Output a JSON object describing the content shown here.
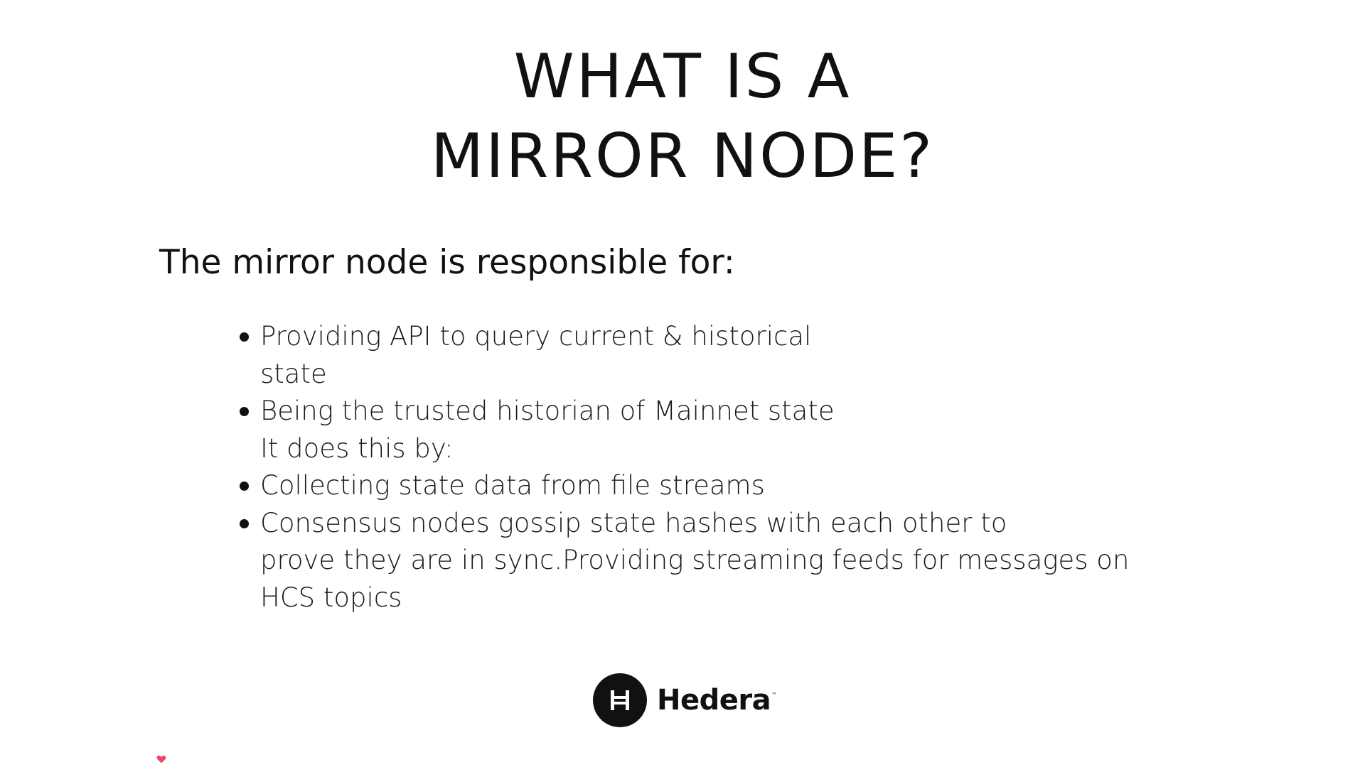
{
  "slide": {
    "title_line1": "WHAT IS A",
    "title_line2": "MIRROR NODE?",
    "subtitle": "The mirror node is responsible for:",
    "bullets": [
      {
        "lines": [
          "Providing API to query current & historical",
          "state"
        ],
        "bullet": true
      },
      {
        "lines": [
          "Being the trusted historian of Mainnet state",
          "It does this by:"
        ],
        "bullet": true
      },
      {
        "lines": [
          "Collecting state data from file streams"
        ],
        "bullet": true
      },
      {
        "lines": [
          "Consensus nodes gossip state hashes with each other to",
          "prove they are in sync.Providing streaming feeds for messages on",
          "HCS topics"
        ],
        "bullet": true
      }
    ]
  },
  "logo": {
    "wordmark": "Hedera",
    "trademark": "™",
    "icon": "hedera-h-icon"
  },
  "decor": {
    "icon": "heart-icon",
    "color": "#e8476a"
  },
  "colors": {
    "background": "#ffffff",
    "text": "#111111"
  }
}
